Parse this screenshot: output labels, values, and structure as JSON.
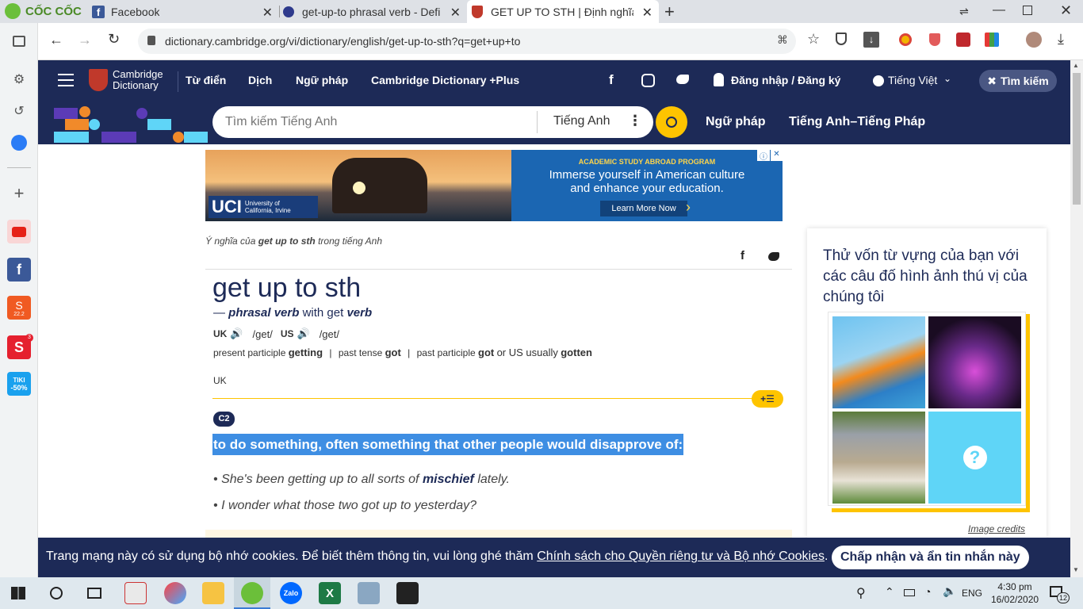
{
  "browser": {
    "brand": "CỐC CỐC",
    "tabs": [
      {
        "title": "Facebook",
        "close": "✕"
      },
      {
        "title": "get-up-to phrasal verb - Defi",
        "close": "✕"
      },
      {
        "title": "GET UP TO STH | Định nghĩa t",
        "close": "✕"
      }
    ],
    "new_tab": "+",
    "url": "dictionary.cambridge.org/vi/dictionary/english/get-up-to-sth?q=get+up+to"
  },
  "sidebar": {
    "items": [
      "settings-icon",
      "history-icon",
      "messenger-icon",
      "add-icon",
      "youtube-icon",
      "facebook-icon",
      "shopee-icon",
      "sendo-icon",
      "tiki-icon"
    ],
    "shopee_badge": "22.2",
    "sendo_badge": "3",
    "tiki_label": "TIKI",
    "tiki_badge": "-50%"
  },
  "header": {
    "logo_line1": "Cambridge",
    "logo_line2": "Dictionary",
    "nav": [
      "Từ điển",
      "Dịch",
      "Ngữ pháp",
      "Cambridge Dictionary +Plus"
    ],
    "login": "Đăng nhập / Đăng ký",
    "language": "Tiếng Việt",
    "search_button": "Tìm kiếm",
    "search_placeholder": "Tìm kiếm Tiếng Anh",
    "search_dict": "Tiếng Anh",
    "link_grammar": "Ngữ pháp",
    "link_en_fr": "Tiếng Anh–Tiếng Pháp"
  },
  "ad": {
    "uci": "UCI",
    "uci_sub1": "University of",
    "uci_sub2": "California, Irvine",
    "program": "ACADEMIC STUDY ABROAD PROGRAM",
    "line1": "Immerse yourself in American culture",
    "line2": "and enhance your education.",
    "cta": "Learn More Now"
  },
  "entry": {
    "meaning_prefix": "Ý nghĩa của",
    "meaning_word": "get up to sth",
    "meaning_suffix": "trong tiếng Anh",
    "headword": "get up to sth",
    "pos_dash": "—",
    "pos": "phrasal verb",
    "with": "with get",
    "verb": "verb",
    "uk": "UK",
    "uk_ipa": "/get/",
    "us": "US",
    "us_ipa": "/get/",
    "forms": {
      "pp_label": "present participle",
      "pp": "getting",
      "sep": "|",
      "pt_label": "past tense",
      "pt": "got",
      "pap_label": "past participle",
      "pap": "got",
      "or": "or US usually",
      "pap2": "gotten"
    },
    "region": "UK",
    "level": "C2",
    "definition": "to do something, often something that other people would disapprove of:",
    "examples": [
      {
        "pre": "She's been getting up to all sorts of ",
        "bold": "mischief",
        "post": " lately."
      },
      {
        "pre": "I wonder what those two got up to yesterday?",
        "bold": "",
        "post": ""
      }
    ]
  },
  "quiz": {
    "title": "Thử vốn từ vựng của bạn với các câu đố hình ảnh thú vị của chúng tôi",
    "credits": "Image credits",
    "question_mark": "?"
  },
  "cookie": {
    "text": "Trang mạng này có sử dụng bộ nhớ cookies. Để biết thêm thông tin, vui lòng ghé thăm",
    "link": "Chính sách cho Quyền riêng tư và Bộ nhớ Cookies",
    "period": ".",
    "button": "Chấp nhận và ẩn tin nhắn này"
  },
  "taskbar": {
    "lang": "ENG",
    "time": "4:30 pm",
    "date": "16/02/2020",
    "notif": "12",
    "zalo": "Zalo"
  },
  "colors": {
    "navy": "#1d2a57",
    "yellow": "#fec400",
    "highlight": "#3e8ee3"
  }
}
